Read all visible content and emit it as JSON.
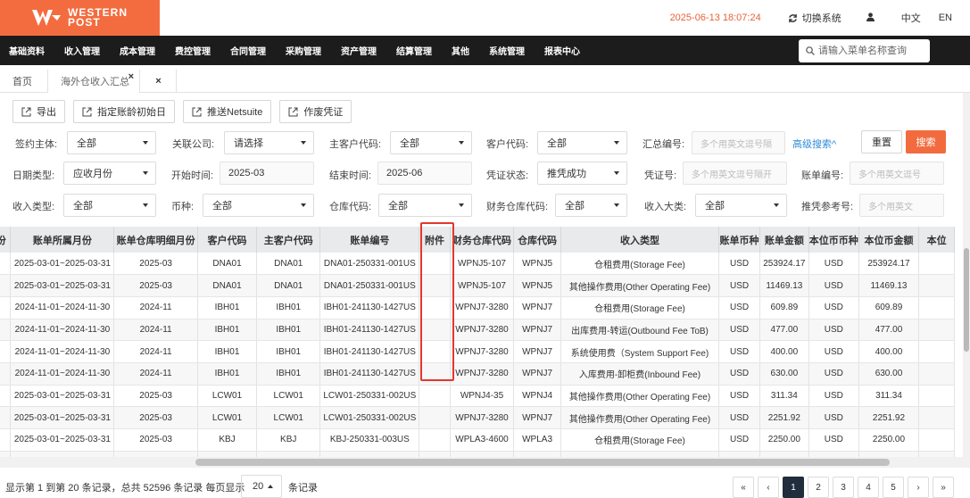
{
  "brand": {
    "line1": "WESTERN",
    "line2": "POST",
    "color": "#f36c3f"
  },
  "header": {
    "datetime": "2025-06-13 18:07:24",
    "switch_system": "切换系统",
    "lang_zh": "中文",
    "lang_en": "EN"
  },
  "nav": {
    "items": [
      "基础资料",
      "收入管理",
      "成本管理",
      "费控管理",
      "合同管理",
      "采购管理",
      "资产管理",
      "结算管理",
      "其他",
      "系统管理",
      "报表中心"
    ],
    "search_placeholder": "请输入菜单名称查询"
  },
  "tabs": {
    "home": "首页",
    "active": "海外仓收入汇总",
    "close_icon": "×"
  },
  "toolbar": {
    "export": "导出",
    "set_date": "指定账龄初始日",
    "push": "推送Netsuite",
    "void": "作废凭证"
  },
  "filters": {
    "signing_entity_label": "签约主体:",
    "signing_entity_value": "全部",
    "related_company_label": "关联公司:",
    "related_company_value": "请选择",
    "main_customer_label": "主客户代码:",
    "main_customer_value": "全部",
    "customer_label": "客户代码:",
    "customer_value": "全部",
    "summary_no_label": "汇总编号:",
    "summary_no_placeholder": "多个用英文逗号隔",
    "advanced": "高级搜索^",
    "reset": "重置",
    "search": "搜索",
    "date_type_label": "日期类型:",
    "date_type_value": "应收月份",
    "start_label": "开始时间:",
    "start_value": "2025-03",
    "end_label": "结束时间:",
    "end_value": "2025-06",
    "voucher_status_label": "凭证状态:",
    "voucher_status_value": "推凭成功",
    "voucher_no_label": "凭证号:",
    "voucher_no_placeholder": "多个用英文逗号隔开",
    "bill_no_label": "账单编号:",
    "bill_no_placeholder": "多个用英文逗号",
    "income_type_label": "收入类型:",
    "income_type_value": "全部",
    "currency_label": "币种:",
    "currency_value": "全部",
    "warehouse_label": "仓库代码:",
    "warehouse_value": "全部",
    "fin_warehouse_label": "财务仓库代码:",
    "fin_warehouse_value": "全部",
    "income_cat_label": "收入大类:",
    "income_cat_value": "全部",
    "push_ref_label": "推凭参考号:",
    "push_ref_placeholder": "多个用英文"
  },
  "table": {
    "headers": [
      "份",
      "账单所属月份",
      "账单仓库明细月份",
      "客户代码",
      "主客户代码",
      "账单编号",
      "附件",
      "财务仓库代码",
      "仓库代码",
      "收入类型",
      "账单币种",
      "账单金额",
      "本位币币种",
      "本位币金额",
      "本位"
    ],
    "rows": [
      [
        "",
        "2025-03-01~2025-03-31",
        "2025-03",
        "DNA01",
        "DNA01",
        "DNA01-250331-001US",
        "",
        "WPNJ5-107",
        "WPNJ5",
        "仓租费用(Storage Fee)",
        "USD",
        "253924.17",
        "USD",
        "253924.17",
        ""
      ],
      [
        "",
        "2025-03-01~2025-03-31",
        "2025-03",
        "DNA01",
        "DNA01",
        "DNA01-250331-001US",
        "",
        "WPNJ5-107",
        "WPNJ5",
        "其他操作费用(Other Operating Fee)",
        "USD",
        "11469.13",
        "USD",
        "11469.13",
        ""
      ],
      [
        "",
        "2024-11-01~2024-11-30",
        "2024-11",
        "IBH01",
        "IBH01",
        "IBH01-241130-1427US",
        "",
        "WPNJ7-3280",
        "WPNJ7",
        "仓租费用(Storage Fee)",
        "USD",
        "609.89",
        "USD",
        "609.89",
        ""
      ],
      [
        "",
        "2024-11-01~2024-11-30",
        "2024-11",
        "IBH01",
        "IBH01",
        "IBH01-241130-1427US",
        "",
        "WPNJ7-3280",
        "WPNJ7",
        "出库费用-转运(Outbound Fee ToB)",
        "USD",
        "477.00",
        "USD",
        "477.00",
        ""
      ],
      [
        "",
        "2024-11-01~2024-11-30",
        "2024-11",
        "IBH01",
        "IBH01",
        "IBH01-241130-1427US",
        "",
        "WPNJ7-3280",
        "WPNJ7",
        "系统使用费（System Support Fee)",
        "USD",
        "400.00",
        "USD",
        "400.00",
        ""
      ],
      [
        "",
        "2024-11-01~2024-11-30",
        "2024-11",
        "IBH01",
        "IBH01",
        "IBH01-241130-1427US",
        "",
        "WPNJ7-3280",
        "WPNJ7",
        "入库费用-卸柜费(Inbound Fee)",
        "USD",
        "630.00",
        "USD",
        "630.00",
        ""
      ],
      [
        "",
        "2025-03-01~2025-03-31",
        "2025-03",
        "LCW01",
        "LCW01",
        "LCW01-250331-002US",
        "",
        "WPNJ4-35",
        "WPNJ4",
        "其他操作费用(Other Operating Fee)",
        "USD",
        "311.34",
        "USD",
        "311.34",
        ""
      ],
      [
        "",
        "2025-03-01~2025-03-31",
        "2025-03",
        "LCW01",
        "LCW01",
        "LCW01-250331-002US",
        "",
        "WPNJ7-3280",
        "WPNJ7",
        "其他操作费用(Other Operating Fee)",
        "USD",
        "2251.92",
        "USD",
        "2251.92",
        ""
      ],
      [
        "",
        "2025-03-01~2025-03-31",
        "2025-03",
        "KBJ",
        "KBJ",
        "KBJ-250331-003US",
        "",
        "WPLA3-4600",
        "WPLA3",
        "仓租费用(Storage Fee)",
        "USD",
        "2250.00",
        "USD",
        "2250.00",
        ""
      ],
      [
        "",
        "",
        "",
        "",
        "",
        "",
        "",
        "",
        "",
        "",
        "",
        "",
        "",
        "",
        ""
      ]
    ]
  },
  "footer": {
    "summary": "显示第 1 到第 20 条记录，总共 52596 条记录 每页显示",
    "page_size": "20",
    "suffix": "条记录",
    "pages": [
      "«",
      "‹",
      "1",
      "2",
      "3",
      "4",
      "5",
      "›",
      "»"
    ],
    "active_page": "1"
  }
}
